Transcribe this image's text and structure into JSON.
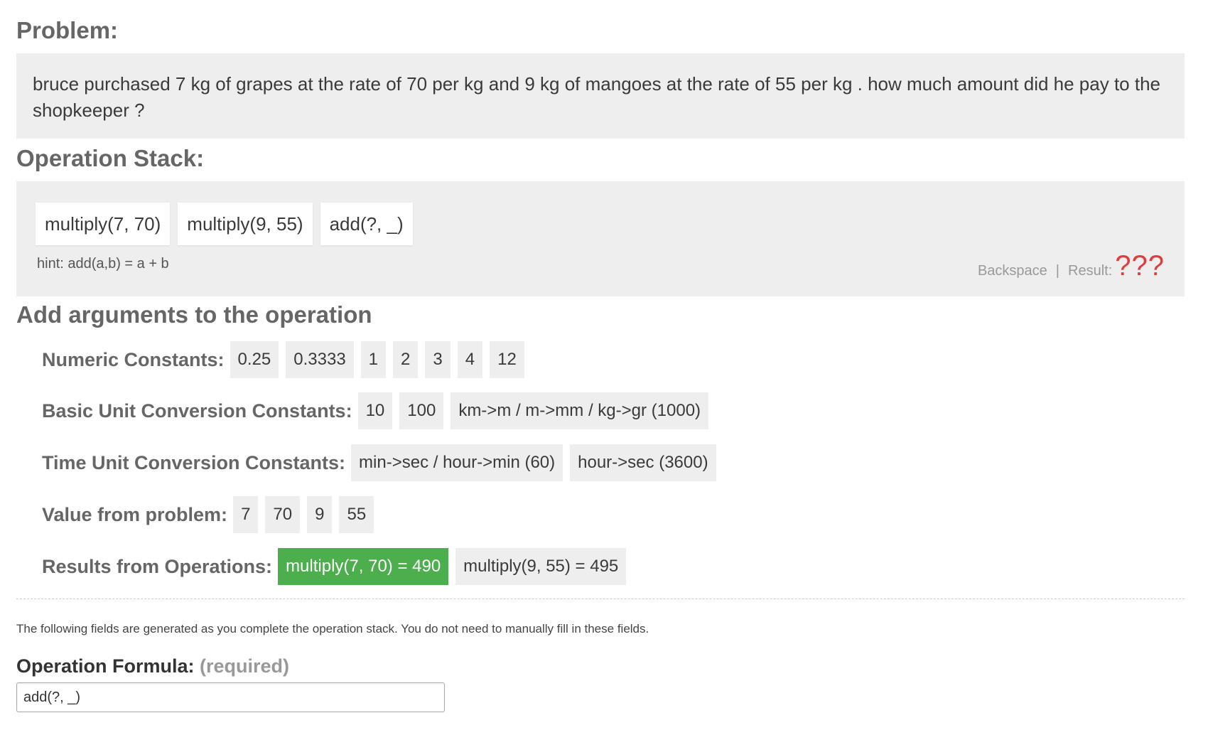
{
  "problem": {
    "title": "Problem:",
    "text": "bruce purchased 7 kg of grapes at the rate of 70 per kg and 9 kg of mangoes at the rate of 55 per kg . how much amount did he pay to the shopkeeper ?"
  },
  "operation_stack": {
    "title": "Operation Stack:",
    "ops": [
      "multiply(7, 70)",
      "multiply(9, 55)",
      "add(?, _)"
    ],
    "hint": "hint: add(a,b) = a + b",
    "backspace_label": "Backspace",
    "separator": "|",
    "result_label": "Result:",
    "result_value": "???"
  },
  "arguments": {
    "title": "Add arguments to the operation",
    "numeric": {
      "label": "Numeric Constants:",
      "items": [
        "0.25",
        "0.3333",
        "1",
        "2",
        "3",
        "4",
        "12"
      ]
    },
    "basic_unit": {
      "label": "Basic Unit Conversion Constants:",
      "items": [
        "10",
        "100",
        "km->m / m->mm / kg->gr (1000)"
      ]
    },
    "time_unit": {
      "label": "Time Unit Conversion Constants:",
      "items": [
        "min->sec / hour->min (60)",
        "hour->sec (3600)"
      ]
    },
    "values": {
      "label": "Value from problem:",
      "items": [
        "7",
        "70",
        "9",
        "55"
      ]
    },
    "results": {
      "label": "Results from Operations:",
      "items": [
        "multiply(7, 70) = 490",
        "multiply(9, 55) = 495"
      ],
      "active_index": 0
    }
  },
  "note": "The following fields are generated as you complete the operation stack. You do not need to manually fill in these fields.",
  "formula": {
    "label": "Operation Formula:",
    "required": "(required)",
    "value": "add(?, _)"
  },
  "colors": {
    "panel_bg": "#eeeeee",
    "active_chip": "#4cae4c",
    "result_red": "#e03c3c"
  }
}
